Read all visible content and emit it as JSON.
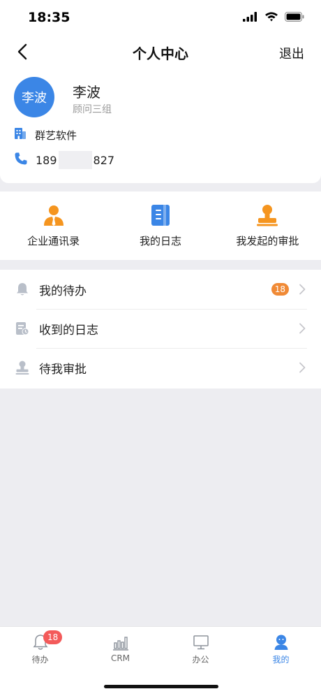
{
  "status_bar": {
    "time": "18:35"
  },
  "nav": {
    "title": "个人中心",
    "logout_label": "退出"
  },
  "profile": {
    "avatar_text": "李波",
    "name": "李波",
    "department": "顾问三组",
    "company": "群艺软件",
    "phone_prefix": "189",
    "phone_suffix": "827"
  },
  "shortcuts": [
    {
      "label": "企业通讯录",
      "icon": "contacts-icon"
    },
    {
      "label": "我的日志",
      "icon": "log-icon"
    },
    {
      "label": "我发起的审批",
      "icon": "approval-stamp-icon"
    }
  ],
  "menu": [
    {
      "label": "我的待办",
      "icon": "bell-icon",
      "badge": "18"
    },
    {
      "label": "收到的日志",
      "icon": "received-log-icon"
    },
    {
      "label": "待我审批",
      "icon": "stamp-icon"
    }
  ],
  "tab_bar": {
    "tabs": [
      {
        "label": "待办",
        "icon": "bell-icon",
        "badge": "18"
      },
      {
        "label": "CRM",
        "icon": "bar-chart-icon"
      },
      {
        "label": "办公",
        "icon": "monitor-icon"
      },
      {
        "label": "我的",
        "icon": "user-icon",
        "active": true
      }
    ]
  },
  "colors": {
    "accent": "#3b86e6",
    "badge_orange": "#f08a36",
    "badge_red": "#f35a5a",
    "shortcut_orange": "#f5951f",
    "background": "#ededf1"
  }
}
